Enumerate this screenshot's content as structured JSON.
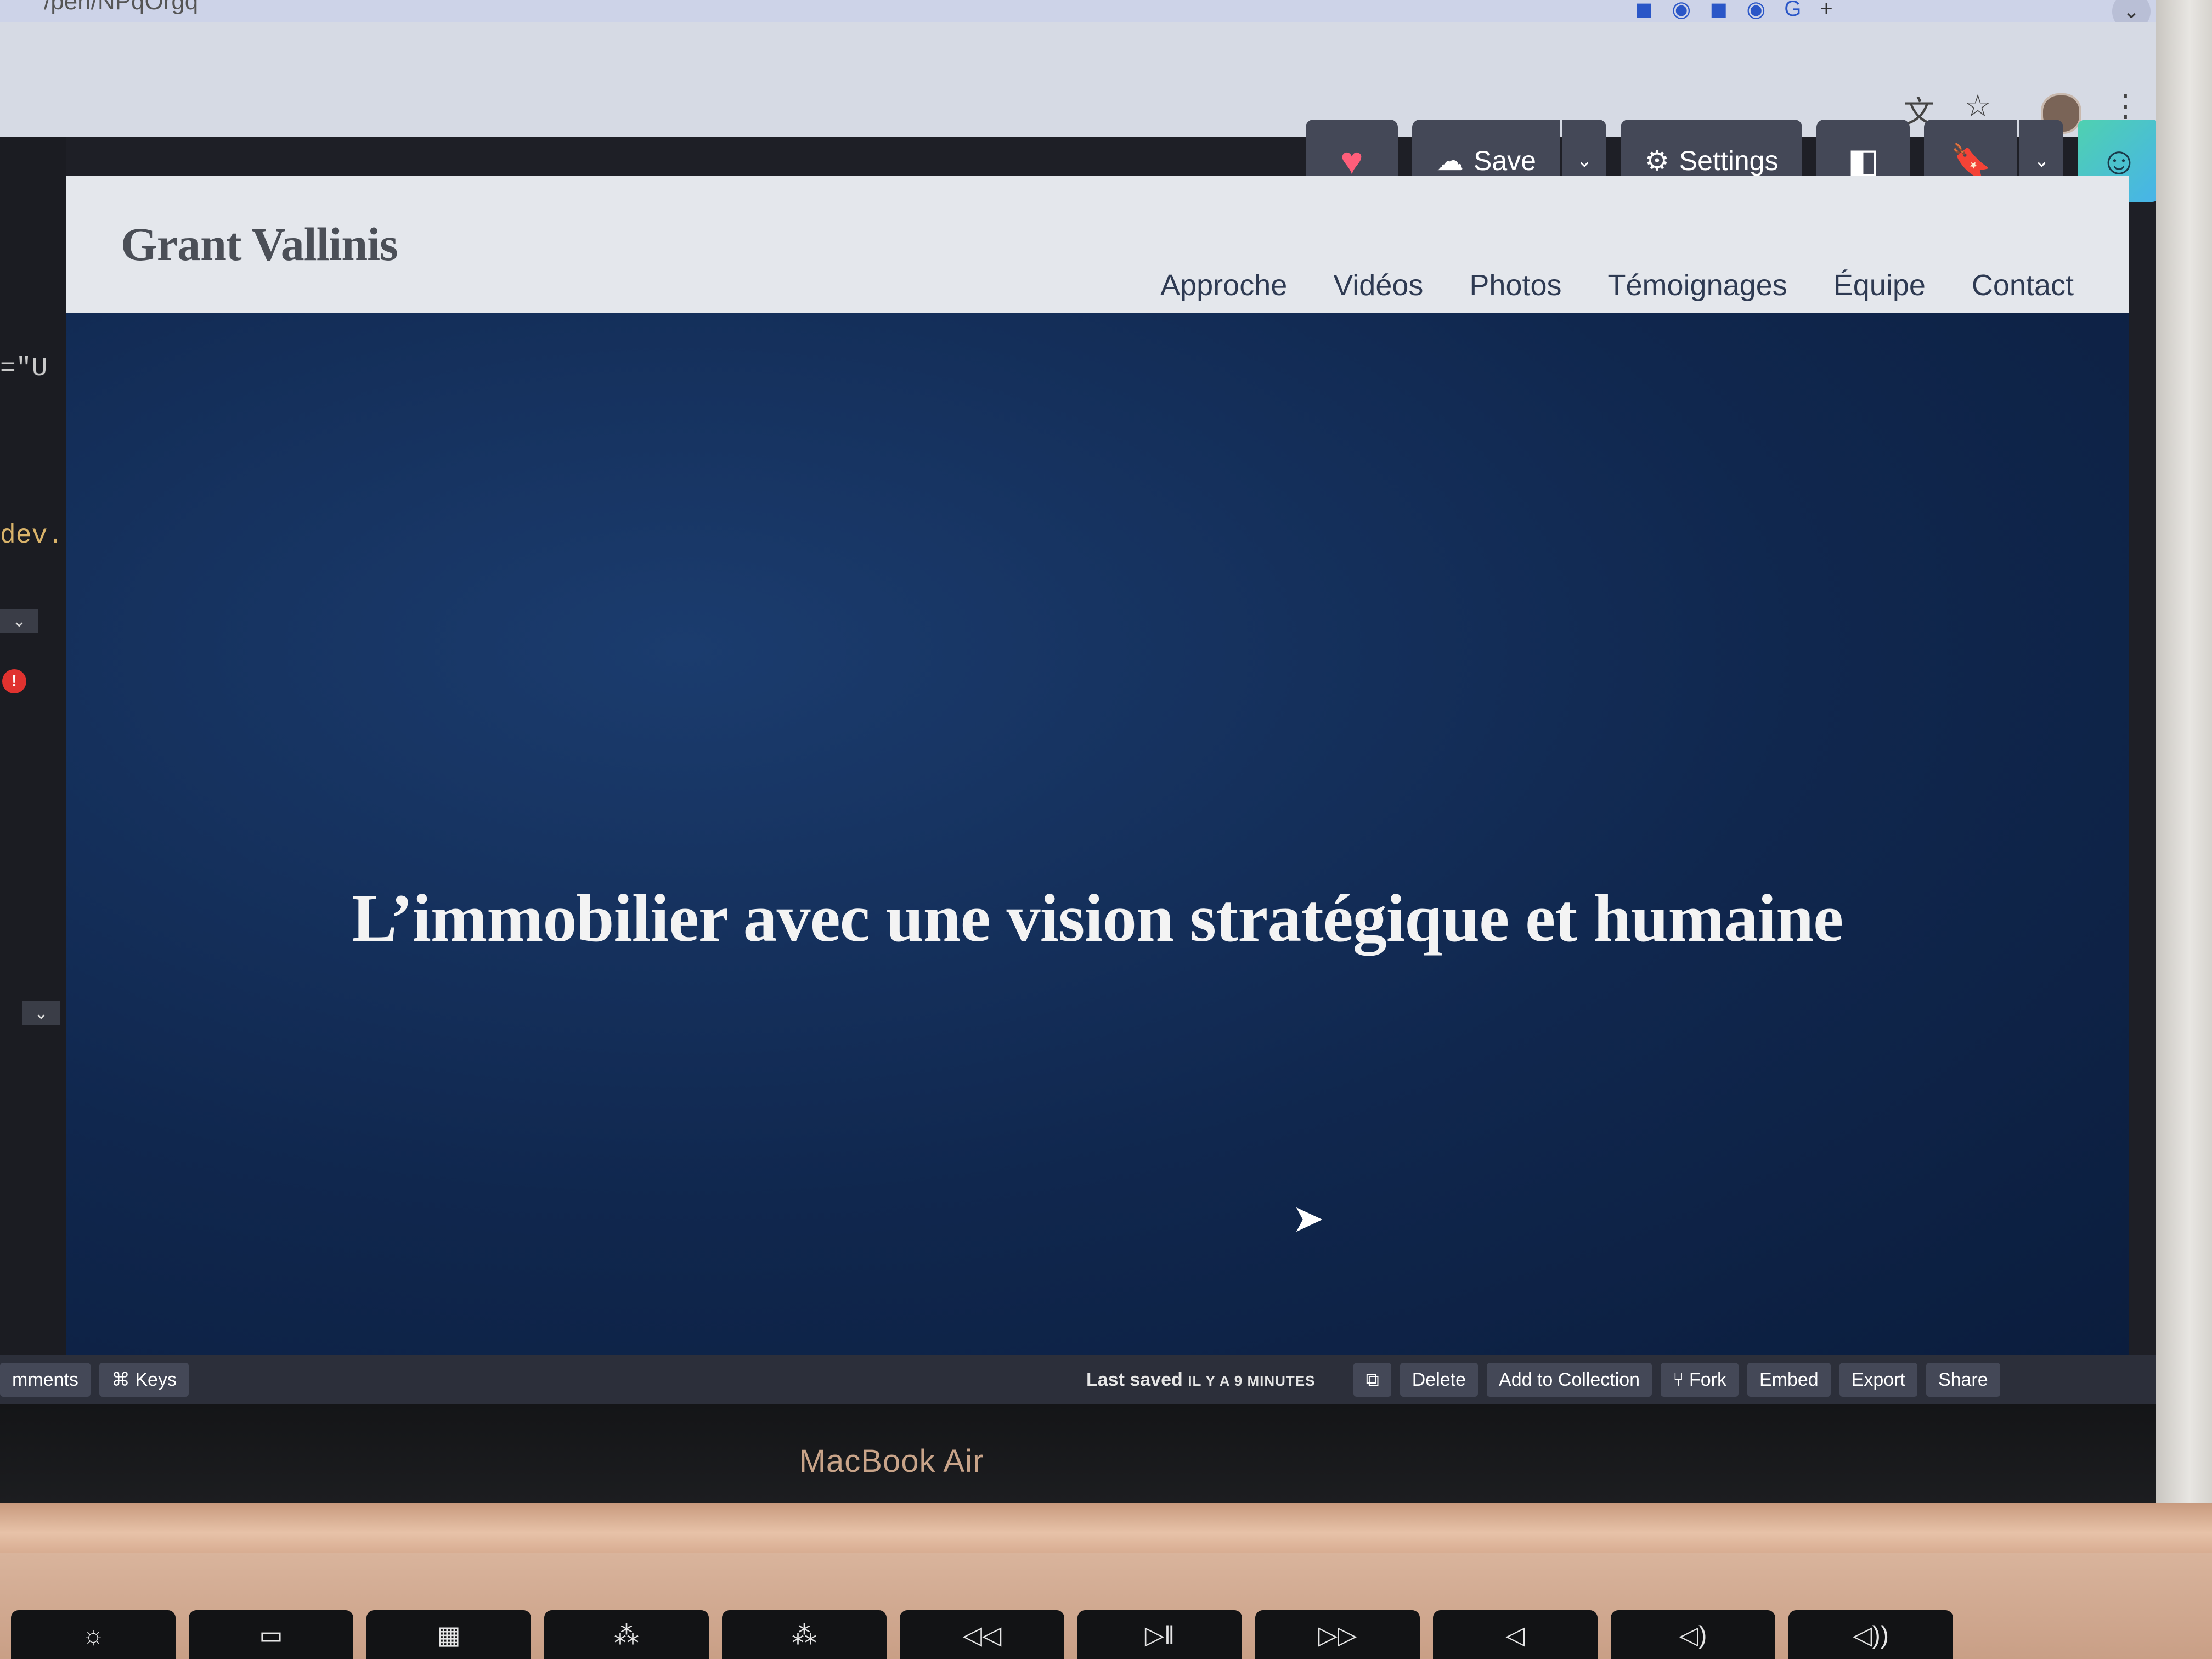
{
  "browser": {
    "url_fragment": "/pen/NPqOrgq",
    "tab_icons": [
      "tab-favicon-1",
      "tab-favicon-2",
      "tab-favicon-3",
      "tab-favicon-4",
      "tab-favicon-5"
    ],
    "new_tab_label": "+",
    "tabstrip_dropdown": "⌄",
    "toolbar_icons": [
      "translate-icon",
      "star-icon",
      "more-icon"
    ]
  },
  "codepen": {
    "actions": {
      "heart_label": "♥",
      "save_label": "Save",
      "settings_label": "Settings"
    },
    "left_editor": {
      "code_fragment_1": "=\"U",
      "code_fragment_2": "dev."
    },
    "footer": {
      "comments_label": "mments",
      "keys_label": "⌘ Keys",
      "last_saved_label": "Last saved",
      "last_saved_time": "IL Y A 9 MINUTES",
      "delete_label": "Delete",
      "add_to_collection_label": "Add to Collection",
      "fork_label": "Fork",
      "embed_label": "Embed",
      "export_label": "Export",
      "share_label": "Share"
    }
  },
  "site": {
    "logo": "Grant Vallinis",
    "nav": [
      "Approche",
      "Vidéos",
      "Photos",
      "Témoignages",
      "Équipe",
      "Contact"
    ],
    "hero_title": "L’immobilier avec une vision stratégique et humaine"
  },
  "device": {
    "brand": "MacBook Air"
  },
  "colors": {
    "preview_bg": "#10274e",
    "header_bg": "#e4e7ec",
    "codepen_button": "#444857",
    "heart": "#ff5e7a"
  }
}
